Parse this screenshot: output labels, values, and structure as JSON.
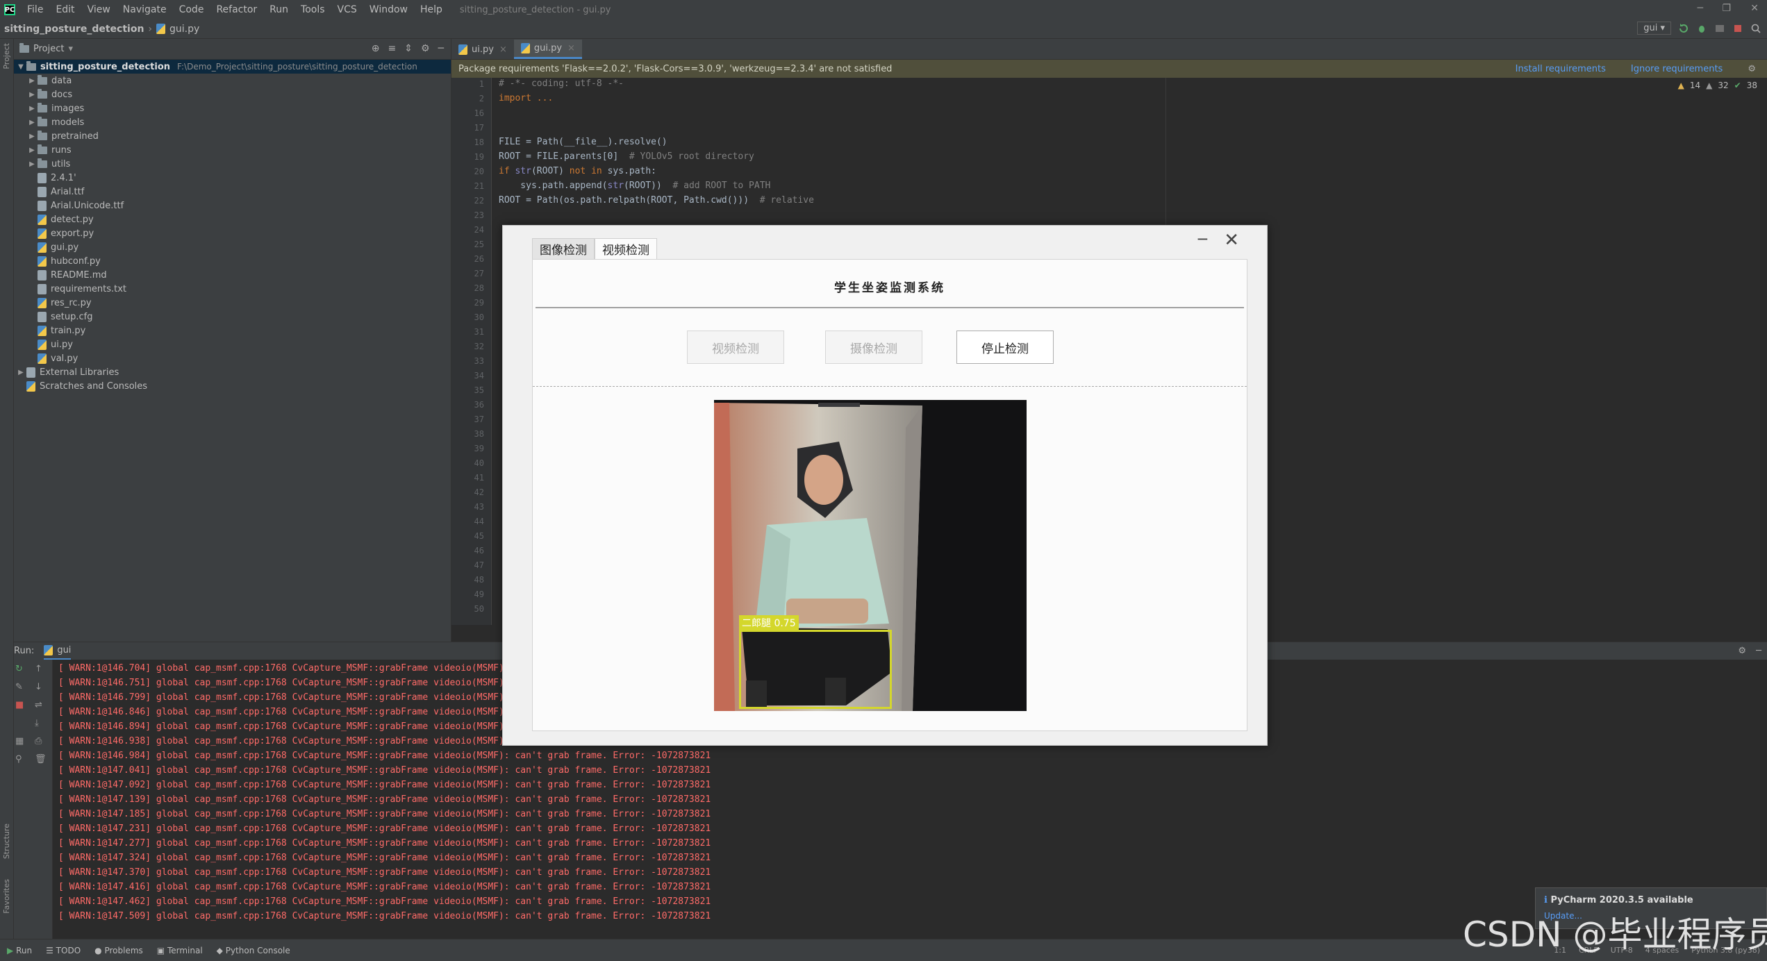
{
  "menubar": {
    "items": [
      "File",
      "Edit",
      "View",
      "Navigate",
      "Code",
      "Refactor",
      "Run",
      "Tools",
      "VCS",
      "Window",
      "Help"
    ],
    "window_title": "sitting_posture_detection - gui.py"
  },
  "navbar": {
    "project": "sitting_posture_detection",
    "file": "gui.py",
    "run_config": "gui"
  },
  "project_panel": {
    "title": "Project",
    "root": "sitting_posture_detection",
    "root_path": "F:\\Demo_Project\\sitting_posture\\sitting_posture_detection",
    "folders": [
      "data",
      "docs",
      "images",
      "models",
      "pretrained",
      "runs",
      "utils"
    ],
    "files": [
      "2.4.1'",
      "Arial.ttf",
      "Arial.Unicode.ttf",
      "detect.py",
      "export.py",
      "gui.py",
      "hubconf.py",
      "README.md",
      "requirements.txt",
      "res_rc.py",
      "setup.cfg",
      "train.py",
      "ui.py",
      "val.py"
    ],
    "external": "External Libraries",
    "scratches": "Scratches and Consoles"
  },
  "editor": {
    "tabs": [
      "ui.py",
      "gui.py"
    ],
    "banner": "Package requirements 'Flask==2.0.2', 'Flask-Cors==3.0.9', 'werkzeug==2.3.4' are not satisfied",
    "banner_links": [
      "Install requirements",
      "Ignore requirements"
    ],
    "inspections": {
      "warnings": "14",
      "weak": "32",
      "ok": "38"
    },
    "line_numbers": [
      "1",
      "2",
      "16",
      "17",
      "18",
      "19",
      "20",
      "21",
      "22",
      "23",
      "24",
      "25",
      "26",
      "27",
      "28",
      "29",
      "30",
      "31",
      "32",
      "33",
      "34",
      "35",
      "36",
      "37",
      "38",
      "39",
      "40",
      "41",
      "42",
      "43",
      "44",
      "45",
      "46",
      "47",
      "48",
      "49",
      "50"
    ],
    "code": {
      "l1": "# -*- coding: utf-8 -*-",
      "l2": "import ...",
      "l18": "FILE = Path(__file__).resolve()",
      "l19a": "ROOT = FILE.parents[0]",
      "l19b": "# YOLOv5 root directory",
      "l20a": "if",
      "l20b": "str",
      "l20c": "(ROOT)",
      "l20d": "not in",
      "l20e": "sys.path:",
      "l21a": "    sys.path.append(",
      "l21b": "str",
      "l21c": "(ROOT))",
      "l21d": "# add ROOT to PATH",
      "l22a": "ROOT = Path(os.path.relpath(ROOT, Path.cwd()))",
      "l22b": "# relative"
    }
  },
  "run": {
    "label": "Run:",
    "config": "gui",
    "warn_times": [
      "146.704",
      "146.751",
      "146.799",
      "146.846",
      "146.894",
      "146.938",
      "146.984",
      "147.041",
      "147.092",
      "147.139",
      "147.185",
      "147.231",
      "147.277",
      "147.324",
      "147.370",
      "147.416",
      "147.462",
      "147.509"
    ],
    "warn_prefix": "[ WARN:1@",
    "warn_text": "] global cap_msmf.cpp:1768 CvCapture_MSMF::grabFrame videoio(MSMF): can't grab frame. Error: -1072873821"
  },
  "bottom_tabs": [
    "Run",
    "TODO",
    "Problems",
    "Terminal",
    "Python Console"
  ],
  "status": [
    "1:1",
    "CRLF",
    "UTF-8",
    "4 spaces",
    "Python 3.8 (py38)"
  ],
  "notification": {
    "title": "PyCharm 2020.3.5 available",
    "link": "Update..."
  },
  "watermark": "CSDN @毕业程序员",
  "side_labels": {
    "project": "Project",
    "structure": "Structure",
    "favorites": "Favorites"
  },
  "dialog": {
    "tabs": [
      "图像检测",
      "视频检测"
    ],
    "active_tab": 1,
    "title": "学生坐姿监测系统",
    "buttons": [
      {
        "label": "视频检测",
        "enabled": false
      },
      {
        "label": "摄像检测",
        "enabled": false
      },
      {
        "label": "停止检测",
        "enabled": true
      }
    ],
    "detection": {
      "label": "二郎腿",
      "confidence": "0.75",
      "box_color": "#d4d72c"
    }
  },
  "colors": {
    "accent": "#4a88c7",
    "error_text": "#ff6b68",
    "banner_bg": "#504f3b"
  }
}
